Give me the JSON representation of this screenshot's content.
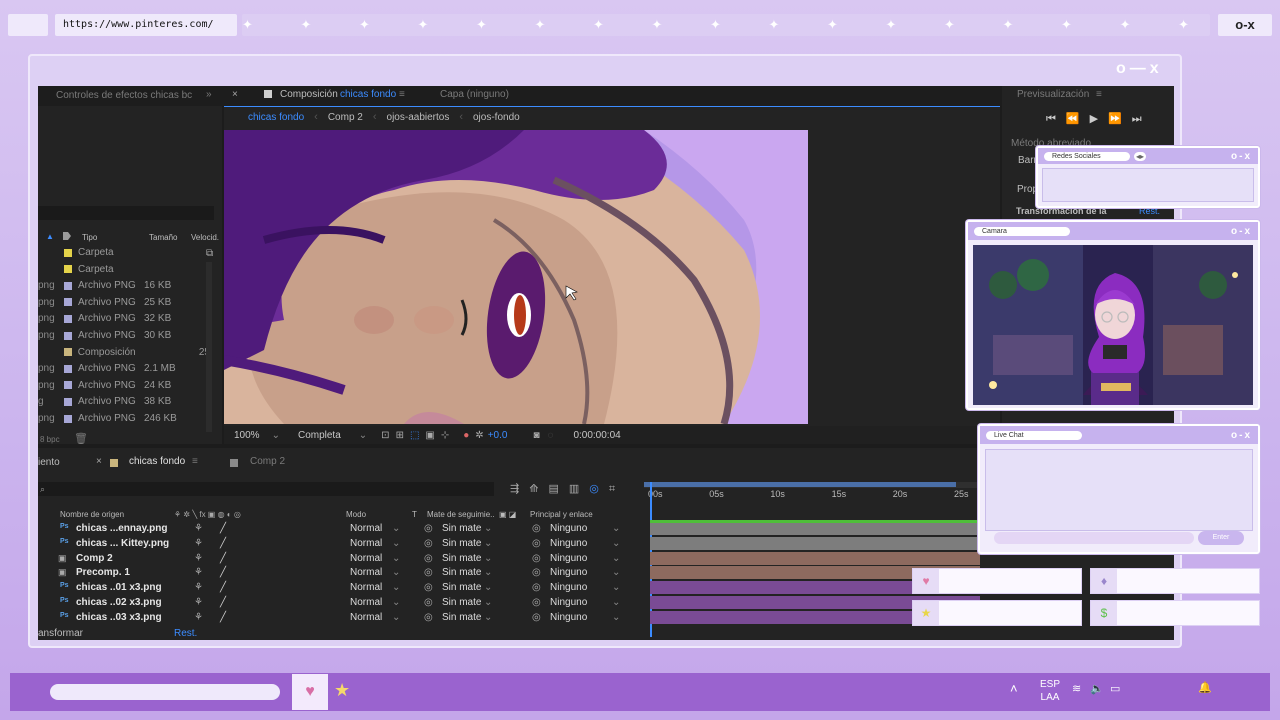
{
  "browser": {
    "url": "https://www.pinteres.com/",
    "stars": "✦ ✦ ✦ ✦ ✦ ✦ ✦ ✦ ✦ ✦ ✦ ✦ ✦ ✦ ✦ ✦ ✦ ✦ ✦ ✦ ✦ ✦ ✦ ✦ ✦ ✦ ✦",
    "controls": "o-x"
  },
  "frame": {
    "controls": "o—x"
  },
  "ae": {
    "effects_panel_title": "Controles de efectos chicas bc",
    "comp_tab": "Composición",
    "comp_name": "chicas fondo",
    "layer_tab": "Capa (ninguno)",
    "breadcrumbs": [
      "chicas fondo",
      "Comp 2",
      "ojos-aabiertos",
      "ojos-fondo"
    ],
    "preview_title": "Previsualización",
    "shortcut_method": "Método abreviado",
    "shortcut_value": "Barr",
    "props_label": "Prop",
    "transform_label": "Transformación de la",
    "reset_label": "Rest.",
    "project_columns": {
      "type": "Tipo",
      "size": "Tamaño",
      "speed": "Velocid."
    },
    "project_rows": [
      {
        "ext": "",
        "type": "Carpeta",
        "size": "",
        "color": "#e4d34a"
      },
      {
        "ext": "",
        "type": "Carpeta",
        "size": "",
        "color": "#e4d34a"
      },
      {
        "ext": "png",
        "type": "Archivo PNG",
        "size": "16 KB",
        "color": "#a7a7d6"
      },
      {
        "ext": "png",
        "type": "Archivo PNG",
        "size": "25 KB",
        "color": "#a7a7d6"
      },
      {
        "ext": "png",
        "type": "Archivo PNG",
        "size": "32 KB",
        "color": "#a7a7d6"
      },
      {
        "ext": "png",
        "type": "Archivo PNG",
        "size": "30 KB",
        "color": "#a7a7d6"
      },
      {
        "ext": "",
        "type": "Composición",
        "size": "",
        "speed": "25",
        "color": "#c9b57d"
      },
      {
        "ext": "png",
        "type": "Archivo PNG",
        "size": "2.1 MB",
        "color": "#a7a7d6"
      },
      {
        "ext": "png",
        "type": "Archivo PNG",
        "size": "24 KB",
        "color": "#a7a7d6"
      },
      {
        "ext": "g",
        "type": "Archivo PNG",
        "size": "38 KB",
        "color": "#a7a7d6"
      },
      {
        "ext": "png",
        "type": "Archivo PNG",
        "size": "246 KB",
        "color": "#a7a7d6"
      }
    ],
    "bpc": "8 bpc",
    "viewer_footer": {
      "zoom": "100%",
      "resolution": "Completa",
      "exposure": "+0.0",
      "timecode": "0:00:00:04"
    },
    "timeline_tabs": {
      "left_cut": "iento",
      "main": "chicas fondo",
      "second": "Comp 2"
    },
    "timeline_search": "",
    "ruler": [
      "00s",
      "05s",
      "10s",
      "15s",
      "20s",
      "25s"
    ],
    "layer_columns": {
      "source": "Nombre de origen",
      "mode": "Modo",
      "t": "T",
      "track": "Mate de seguimie..",
      "parent": "Principal y enlace"
    },
    "layers": [
      {
        "name": "chicas ...ennay.png",
        "kind": "Ps",
        "mode": "Normal",
        "mate": "Sin mate",
        "parent": "Ninguno",
        "color": "#7d7d7d"
      },
      {
        "name": "chicas ... Kittey.png",
        "kind": "Ps",
        "mode": "Normal",
        "mate": "Sin mate",
        "parent": "Ninguno",
        "color": "#7d7d7d"
      },
      {
        "name": "Comp 2",
        "kind": "comp",
        "mode": "Normal",
        "mate": "Sin mate",
        "parent": "Ninguno",
        "color": "#8d6a5f"
      },
      {
        "name": "Precomp. 1",
        "kind": "comp",
        "mode": "Normal",
        "mate": "Sin mate",
        "parent": "Ninguno",
        "color": "#8d6a5f"
      },
      {
        "name": "chicas ..01 x3.png",
        "kind": "Ps",
        "mode": "Normal",
        "mate": "Sin mate",
        "parent": "Ninguno",
        "color": "#7a4b95"
      },
      {
        "name": "chicas ..02 x3.png",
        "kind": "Ps",
        "mode": "Normal",
        "mate": "Sin mate",
        "parent": "Ninguno",
        "color": "#7a4b95"
      },
      {
        "name": "chicas ..03 x3.png",
        "kind": "Ps",
        "mode": "Normal",
        "mate": "Sin mate",
        "parent": "Ninguno",
        "color": "#7a4b95"
      }
    ],
    "footer_transform": "ansformar",
    "footer_reset": "Rest."
  },
  "overlays": {
    "social": {
      "title": "Redes Sociales",
      "controls": "o-x"
    },
    "camera": {
      "title": "Camara",
      "controls": "o-x"
    },
    "chat": {
      "title": "Live Chat",
      "controls": "o-x",
      "send": "Enter"
    }
  },
  "taskbar": {
    "lang_line1": "ESP",
    "lang_line2": "LAA"
  },
  "colors": {
    "accent_purple": "#9a63cf",
    "ae_blue": "#3c8cff",
    "frame_lilac": "#ddd0f4"
  }
}
